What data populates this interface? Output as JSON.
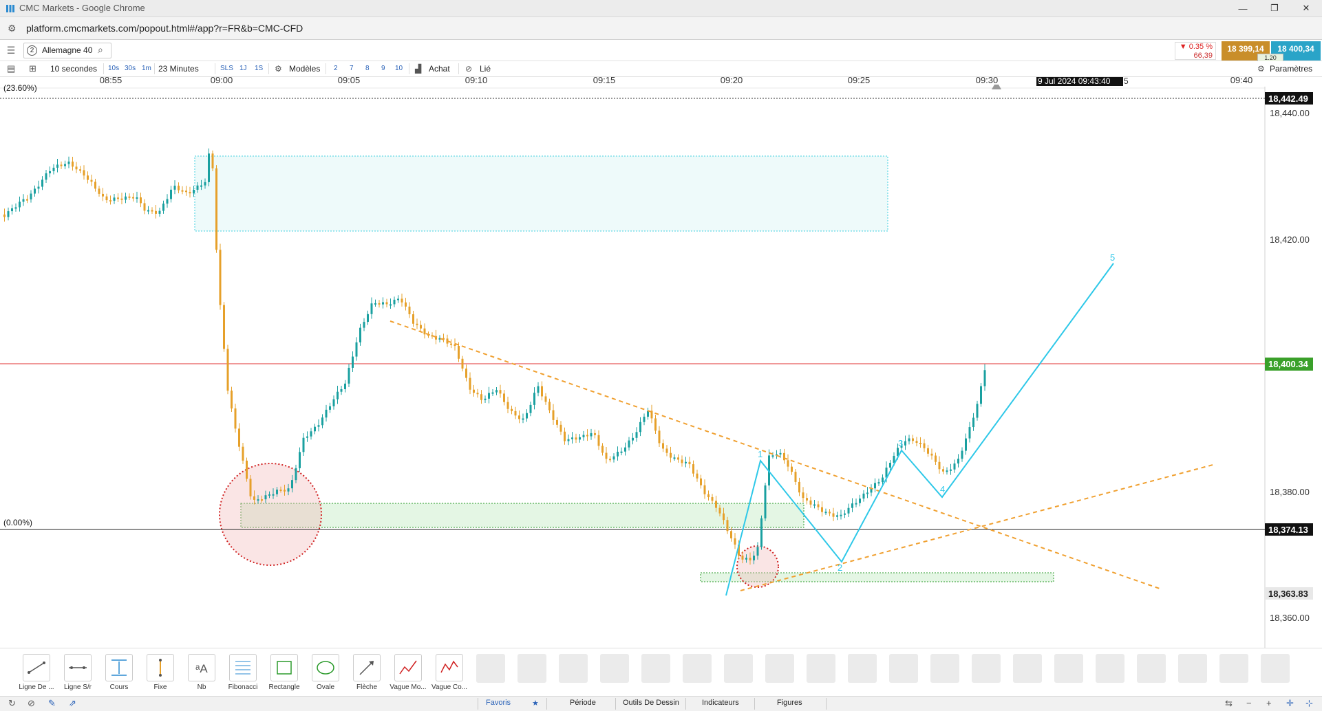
{
  "window": {
    "title": "CMC Markets - Google Chrome",
    "controls": [
      "—",
      "❐",
      "✕"
    ]
  },
  "browser": {
    "url": "platform.cmcmarkets.com/popout.html#/app?r=FR&b=CMC-CFD"
  },
  "header": {
    "instrument_number": "2",
    "instrument_name": "Allemagne 40",
    "change_percent": "▼ 0.35 %",
    "change_points": "66,39",
    "sell_price": "18 399,14",
    "buy_price": "18 400,34",
    "spread": "1.20"
  },
  "toolbar": {
    "interval": "10 secondes",
    "quick_intervals": [
      "10s",
      "30s",
      "1m"
    ],
    "range": "23 Minutes",
    "quick_ranges": [
      "SLS",
      "1J",
      "1S"
    ],
    "models": "Modèles",
    "counts": [
      "2",
      "7",
      "8",
      "9",
      "10"
    ],
    "buy": "Achat",
    "linked": "Lié",
    "settings": "Paramètres"
  },
  "chart": {
    "time_labels": [
      "08:55",
      "09:00",
      "09:05",
      "09:10",
      "09:15",
      "09:20",
      "09:25",
      "09:30",
      "09:40"
    ],
    "cursor_time": "9 Jul 2024 09:43:40",
    "cursor_time_suffix": "5",
    "price_ticks": [
      "18,440.00",
      "18,420.00",
      "18,380.00",
      "18,360.00"
    ],
    "price_tags": {
      "fib_top": "18,442.49",
      "current": "18,400.34",
      "fib_zero": "18,374.13",
      "low": "18,363.83"
    },
    "fib_labels": {
      "top": "(23.60%)",
      "zero": "(0.00%)"
    },
    "wave_labels": [
      "1",
      "2",
      "3",
      "4",
      "5"
    ],
    "colors": {
      "bull_candle": "#1aa0a0",
      "bear_candle": "#e6a02a",
      "current_price_line": "#e03030",
      "current_price_tag": "#3aa02a",
      "elliott_wave": "#2ec8e8",
      "trend_line": "#f0a030"
    }
  },
  "chart_data": {
    "type": "candlestick",
    "x_axis": "time",
    "y_axis": "price",
    "ylim": [
      18356,
      18445
    ],
    "current_price": 18400.34,
    "levels": {
      "fib_23_6": 18442.49,
      "fib_0": 18374.13,
      "low": 18363.83
    }
  },
  "tools": [
    {
      "label": "Ligne De ...",
      "icon": "trend-line-icon"
    },
    {
      "label": "Ligne S/r",
      "icon": "sr-line-icon"
    },
    {
      "label": "Cours",
      "icon": "price-icon"
    },
    {
      "label": "Fixe",
      "icon": "fixed-icon"
    },
    {
      "label": "Nb",
      "icon": "text-icon"
    },
    {
      "label": "Fibonacci",
      "icon": "fibonacci-icon"
    },
    {
      "label": "Rectangle",
      "icon": "rectangle-icon"
    },
    {
      "label": "Ovale",
      "icon": "oval-icon"
    },
    {
      "label": "Flèche",
      "icon": "arrow-icon"
    },
    {
      "label": "Vague Mo...",
      "icon": "motive-wave-icon"
    },
    {
      "label": "Vague Co...",
      "icon": "corrective-wave-icon"
    }
  ],
  "bottom_tabs": [
    "Favoris",
    "Période",
    "Outils De Dessin",
    "Indicateurs",
    "Figures"
  ]
}
